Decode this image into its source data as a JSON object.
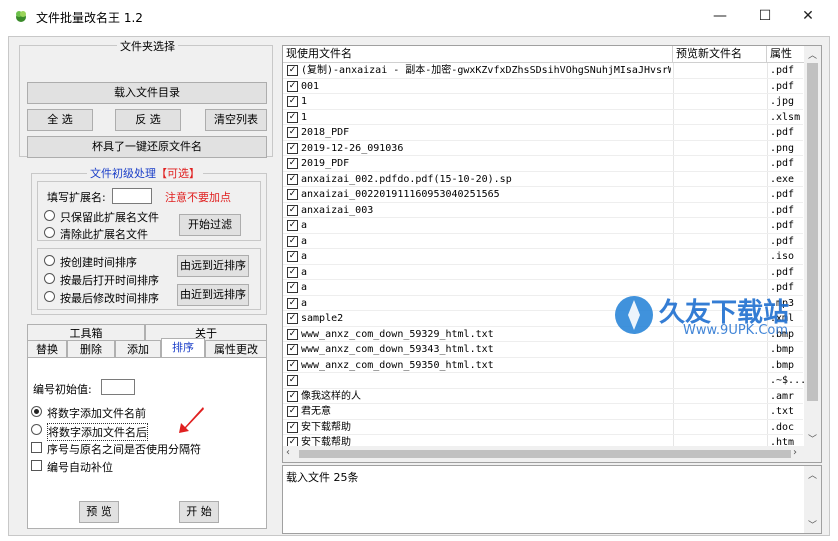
{
  "window": {
    "title": "文件批量改名王 1.2",
    "minimize": "—",
    "maximize": "☐",
    "close": "✕"
  },
  "folder": {
    "legend": "文件夹选择",
    "load_button": "载入文件目录",
    "select_all": "全 选",
    "invert": "反 选",
    "clear_list": "清空列表",
    "restore_button": "杯具了一键还原文件名"
  },
  "pre": {
    "legend": "文件初级处理",
    "optional": "【可选】",
    "ext_label": "填写扩展名:",
    "ext_value": "",
    "warning": "注意不要加点",
    "keep_only": "只保留此扩展名文件",
    "remove_ext": "清除此扩展名文件",
    "filter_button": "开始过滤",
    "sort_created": "按创建时间排序",
    "sort_opened": "按最后打开时间排序",
    "sort_modified": "按最后修改时间排序",
    "far_to_near": "由远到近排序",
    "near_to_far": "由近到远排序"
  },
  "tabs": {
    "row1": [
      "工具箱",
      "关于"
    ],
    "row2": [
      "替换",
      "删除",
      "添加",
      "排序",
      "属性更改"
    ],
    "active": "排序"
  },
  "sortpanel": {
    "start_label": "编号初始值:",
    "start_value": "",
    "add_before": "将数字添加文件名前",
    "add_after": "将数字添加文件名后",
    "use_separator": "序号与原名之间是否使用分隔符",
    "auto_pad": "编号自动补位",
    "preview": "预 览",
    "start": "开 始"
  },
  "grid": {
    "headers": [
      "现使用文件名",
      "预览新文件名",
      "属性"
    ],
    "rows": [
      {
        "name": "(复制)-anxaizai - 副本-加密-gwxKZvfxDZhsSDsihVOhgSNuhjMIsaJHvsrWJv",
        "ext": ".pdf"
      },
      {
        "name": "001",
        "ext": ".pdf"
      },
      {
        "name": "1",
        "ext": ".jpg"
      },
      {
        "name": "1",
        "ext": ".xlsm"
      },
      {
        "name": "2018_PDF",
        "ext": ".pdf"
      },
      {
        "name": "2019-12-26_091036",
        "ext": ".png"
      },
      {
        "name": "2019_PDF",
        "ext": ".pdf"
      },
      {
        "name": "anxaizai_002.pdfdo.pdf(15-10-20).sp",
        "ext": ".exe"
      },
      {
        "name": "anxaizai_0022019111609530402515​65",
        "ext": ".pdf"
      },
      {
        "name": "anxaizai_003",
        "ext": ".pdf"
      },
      {
        "name": "a",
        "ext": ".pdf"
      },
      {
        "name": "a",
        "ext": ".pdf"
      },
      {
        "name": "a",
        "ext": ".iso"
      },
      {
        "name": "a",
        "ext": ".pdf"
      },
      {
        "name": "a",
        "ext": ".pdf"
      },
      {
        "name": "a",
        "ext": ".mp3"
      },
      {
        "name": "sample2",
        "ext": ".xml"
      },
      {
        "name": "www_anxz_com_down_59329_html.txt",
        "ext": ".bmp"
      },
      {
        "name": "www_anxz_com_down_59343_html.txt",
        "ext": ".bmp"
      },
      {
        "name": "www_anxz_com_down_59350_html.txt",
        "ext": ".bmp"
      },
      {
        "name": "",
        "ext": ".~$..."
      },
      {
        "name": "像我这样的人",
        "ext": ".amr"
      },
      {
        "name": "君无意",
        "ext": ".txt"
      },
      {
        "name": "安下载帮助",
        "ext": ".doc"
      },
      {
        "name": "安下载帮助",
        "ext": ".htm"
      }
    ]
  },
  "log": {
    "text": "载入文件  25条"
  },
  "watermark": {
    "brand": "久友下载站",
    "url": "Www.9UPK.Com"
  },
  "colors": {
    "warning": "#e02020",
    "legend_blue": "#1a3ec8",
    "optional_red": "#e02020",
    "arrow": "#e02020"
  }
}
